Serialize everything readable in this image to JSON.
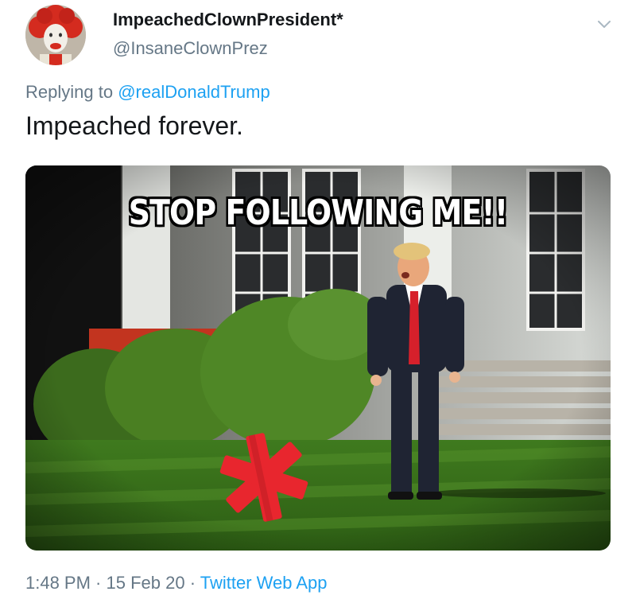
{
  "header": {
    "display_name": "ImpeachedClownPresident*",
    "handle": "@InsaneClownPrez",
    "avatar_icon": "clown-avatar",
    "menu_icon": "chevron-down-icon"
  },
  "reply": {
    "prefix": "Replying to",
    "mention": "@realDonaldTrump"
  },
  "tweet": {
    "text": "Impeached forever."
  },
  "media": {
    "caption": "STOP FOLLOWING ME!!"
  },
  "meta": {
    "time": "1:48 PM",
    "separator_1": " · ",
    "date": "15 Feb 20",
    "separator_2": " · ",
    "source": "Twitter Web App"
  },
  "colors": {
    "link": "#1da1f2",
    "secondary_text": "#657786",
    "primary_text": "#14171a",
    "asterisk": "#e8262e"
  }
}
